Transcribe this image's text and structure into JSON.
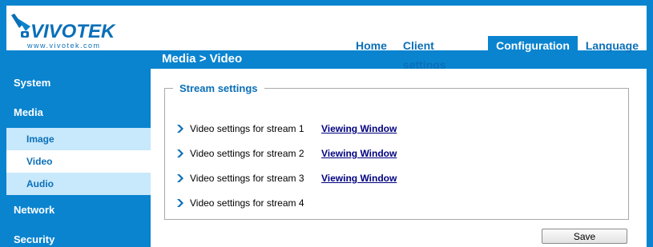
{
  "brand": {
    "name": "VIVOTEK",
    "url": "www.vivotek.com"
  },
  "nav": {
    "home": "Home",
    "client_settings": "Client settings",
    "configuration": "Configuration",
    "language": "Language"
  },
  "title": {
    "section": "Media",
    "page": "> Video"
  },
  "sidebar": {
    "system": "System",
    "media": "Media",
    "media_items": [
      "Image",
      "Video",
      "Audio"
    ],
    "network": "Network",
    "security": "Security"
  },
  "stream_settings": {
    "legend": "Stream settings",
    "streams": [
      {
        "label": "Video settings for stream 1",
        "link": "Viewing Window"
      },
      {
        "label": "Video settings for stream 2",
        "link": "Viewing Window"
      },
      {
        "label": "Video settings for stream 3",
        "link": "Viewing Window"
      },
      {
        "label": "Video settings for stream 4",
        "link": null
      }
    ]
  },
  "save_label": "Save",
  "colors": {
    "brand_blue": "#0a84cf",
    "link_blue": "#0a6fb8",
    "submenu_bg": "#c8e8fb",
    "link_dark": "#000080"
  }
}
